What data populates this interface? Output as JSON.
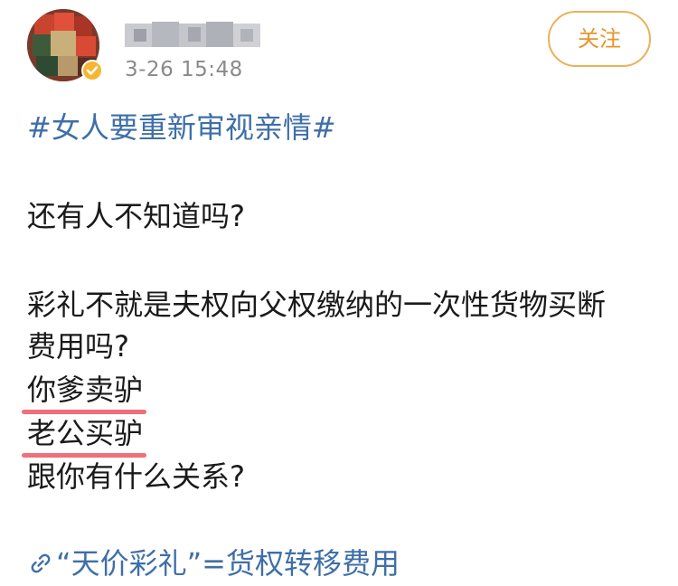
{
  "header": {
    "username": "",
    "timestamp": "3-26 15:48",
    "follow_label": "关注"
  },
  "content": {
    "hashtag": "#女人要重新审视亲情#",
    "lines": [
      "还有人不知道吗?",
      "彩礼不就是夫权向父权缴纳的一次性货物买断",
      "费用吗?",
      "你爹卖驴",
      "老公买驴",
      "跟你有什么关系?"
    ],
    "link_text": "“天价彩礼”=货权转移费用"
  },
  "icons": {
    "link": "link-icon",
    "verified": "verified-badge-icon"
  },
  "colors": {
    "link": "#3f6fa8",
    "follow_accent": "#e8942c",
    "underline_mark": "#ef6f7a",
    "timestamp": "#8a8a8a"
  }
}
